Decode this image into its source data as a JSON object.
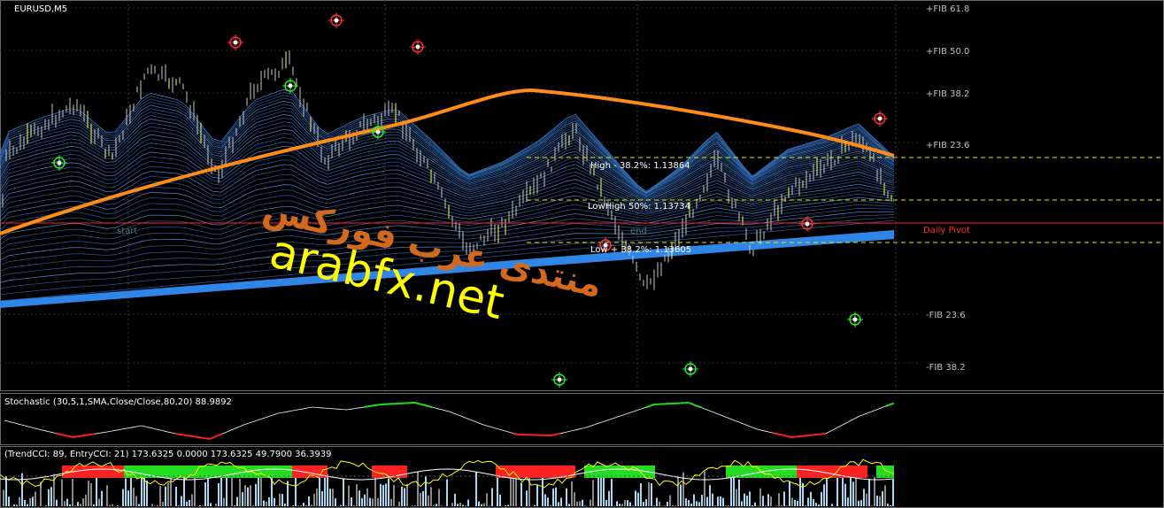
{
  "main_panel": {
    "symbol": "EURUSD,M5",
    "fib_levels": [
      "+FIB 61.8",
      "+FIB 50.0",
      "+FIB 38.2",
      "+FIB 23.6",
      "-FIB 23.6",
      "-FIB 38.2"
    ],
    "high_label": "High - 38.2%: 1.13864",
    "lowhigh_label": "LowHigh 50%: 1.13734",
    "low_label": "Low + 38.2%: 1.13605",
    "daily_pivot_label": "Daily Pivot",
    "start_label": "start",
    "end_label": "end",
    "colors": {
      "fan": "#3a78c8",
      "ma": "#ff8c1a",
      "pivot": "#ff2020",
      "fib_dash": "#e8e800",
      "grid": "#3a3a3a"
    }
  },
  "watermark": {
    "arabic": "منتدى عرب فوركس",
    "site": "arabfx.net"
  },
  "stochastic_panel": {
    "label": "Stochastic (30,5,1,SMA,Close/Close,80,20) 88.9892"
  },
  "cci_panel": {
    "label": "(TrendCCI: 89, EntryCCI: 21)  173.6325  0.0000  173.6325  49.7900  36.3939"
  },
  "chart_data": {
    "type": "line",
    "title": "EURUSD,M5",
    "xlabel": "",
    "ylabel": "",
    "grid": true,
    "price_levels": [
      {
        "label": "High - 38.2%",
        "value": 1.13864
      },
      {
        "label": "LowHigh 50%",
        "value": 1.13734
      },
      {
        "label": "Low + 38.2%",
        "value": 1.13605
      }
    ],
    "series": [
      {
        "values": [
          52,
          60,
          66,
          52,
          74,
          70,
          48,
          70,
          76,
          52,
          60,
          64,
          48,
          30,
          36,
          46,
          60,
          40,
          20,
          34,
          52,
          30,
          44,
          50,
          58,
          42
        ]
      },
      {
        "name": "Stochastic",
        "values": [
          50,
          30,
          12,
          24,
          38,
          20,
          8,
          40,
          66,
          80,
          74,
          86,
          90,
          70,
          40,
          18,
          16,
          34,
          60,
          86,
          90,
          60,
          30,
          12,
          20,
          60,
          88.9892
        ]
      }
    ]
  }
}
